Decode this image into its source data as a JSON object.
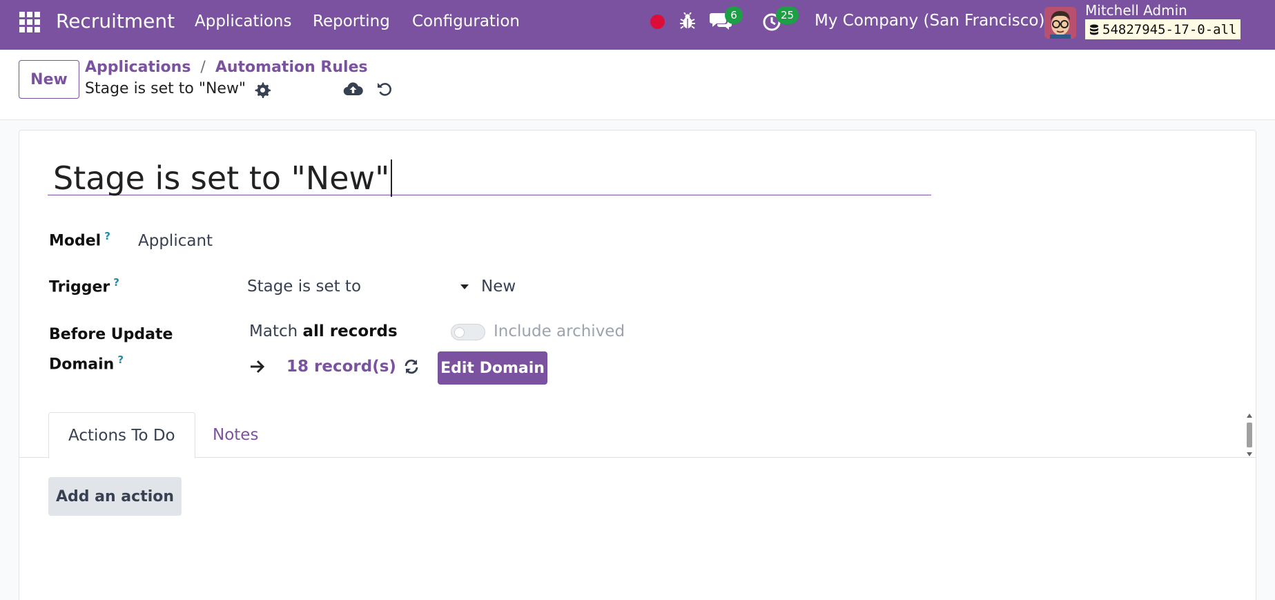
{
  "navbar": {
    "app_name": "Recruitment",
    "menu": [
      "Applications",
      "Reporting",
      "Configuration"
    ],
    "messages_count": "6",
    "activities_count": "25",
    "company": "My Company (San Francisco)",
    "user_name": "Mitchell Admin",
    "database": "54827945-17-0-all",
    "colors": {
      "brand": "#7b529f",
      "record_dot": "#dc0d38",
      "badge": "#1d9f46"
    }
  },
  "control": {
    "new_label": "New",
    "breadcrumbs": [
      "Applications",
      "Automation Rules"
    ],
    "record_title": "Stage is set to \"New\""
  },
  "form": {
    "name": "Stage is set to \"New\"",
    "model_label": "Model",
    "model_value": "Applicant",
    "trigger_label": "Trigger",
    "trigger_value": "Stage is set to",
    "trigger_stage": "New",
    "domain_label_1": "Before Update",
    "domain_label_2": "Domain",
    "match_prefix": "Match",
    "match_strong": "all records",
    "include_archived": "Include archived",
    "records_link": "18 record(s)",
    "edit_domain": "Edit Domain",
    "help_mark": "?"
  },
  "tabs": [
    "Actions To Do",
    "Notes"
  ],
  "actions": {
    "add_action": "Add an action"
  }
}
